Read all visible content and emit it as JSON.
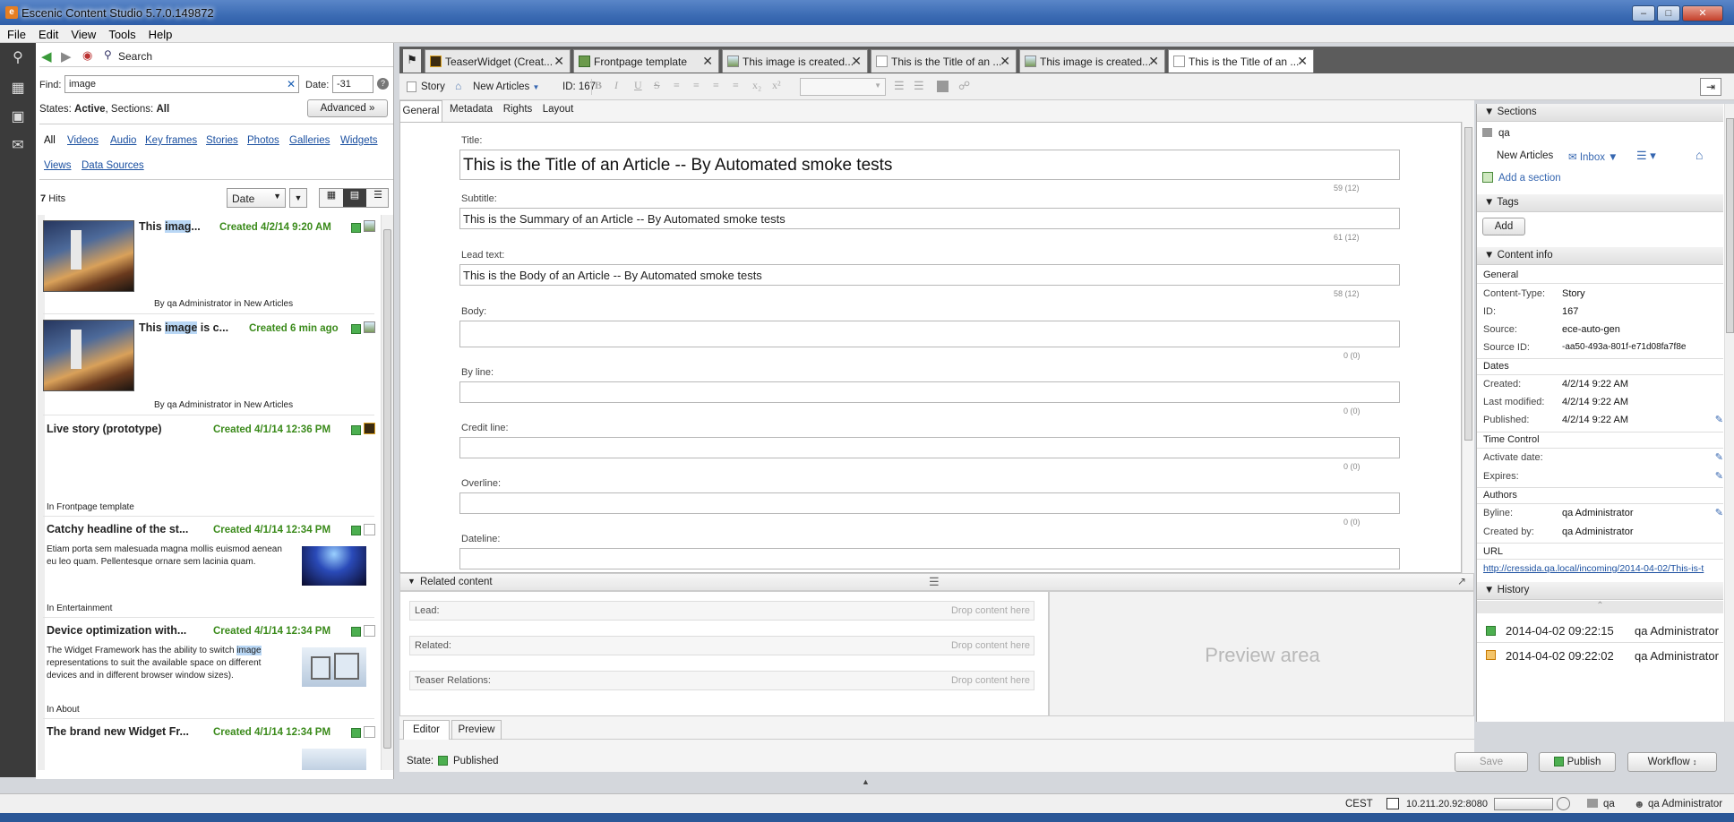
{
  "window": {
    "title": "Escenic Content Studio 5.7.0.149872",
    "app_icon_letter": "e"
  },
  "menu": [
    "File",
    "Edit",
    "View",
    "Tools",
    "Help"
  ],
  "search": {
    "nav_label": "Search",
    "find_label": "Find:",
    "find_value": "image",
    "date_label": "Date:",
    "date_value": "-31",
    "states_prefix": "States:",
    "states_value": "Active",
    "sections_prefix": ", Sections:",
    "sections_value": "All",
    "advanced_label": "Advanced",
    "filters_row1": [
      "All",
      "Videos",
      "Audio",
      "Key frames",
      "Stories",
      "Photos",
      "Galleries",
      "Widgets"
    ],
    "filters_row2": [
      "Views",
      "Data Sources"
    ],
    "hits_count": "7",
    "hits_label": "Hits",
    "sort_value": "Date"
  },
  "results": [
    {
      "title_pre": "This ",
      "title_hl": "imag",
      "title_post": "...",
      "created": "Created 4/2/14 9:20 AM",
      "by_prefix": "By",
      "by": "qa Administrator",
      "in_word": "in",
      "section": "New Articles"
    },
    {
      "title_pre": "This ",
      "title_hl": "image",
      "title_post": " is c...",
      "created": "Created 6 min ago",
      "by_prefix": "By",
      "by": "qa Administrator",
      "in_word": "in",
      "section": "New Articles"
    },
    {
      "title": "Live story (prototype)",
      "created": "Created 4/1/14 12:36 PM",
      "in_word": "In",
      "section": "Frontpage template"
    },
    {
      "title": "Catchy headline of the st...",
      "created": "Created 4/1/14 12:34 PM",
      "body": "Etiam porta sem malesuada magna mollis euismod aenean eu leo quam. Pellentesque ornare sem lacinia quam.",
      "in_word": "In",
      "section": "Entertainment"
    },
    {
      "title": "Device optimization with...",
      "created": "Created 4/1/14 12:34 PM",
      "body_pre": "The Widget Framework has the ability to switch ",
      "body_hl": "image",
      "body_post": " representations to suit the available space on different devices and in different browser window sizes).",
      "in_word": "In",
      "section": "About"
    },
    {
      "title": "The brand new Widget Fr...",
      "created": "Created 4/1/14 12:34 PM"
    }
  ],
  "tabs": [
    {
      "label": "TeaserWidget (Creat...",
      "icon": "widget-icon"
    },
    {
      "label": "Frontpage template",
      "icon": "page-icon"
    },
    {
      "label": "This image is created...",
      "icon": "image-icon"
    },
    {
      "label": "This is the Title of an ...",
      "icon": "doc-icon"
    },
    {
      "label": "This image is created...",
      "icon": "image-icon"
    },
    {
      "label": "This is the Title of an ...",
      "icon": "doc-icon",
      "active": true
    }
  ],
  "toolbar": {
    "type_label": "Story",
    "section_label": "New Articles",
    "id_label": "ID: 167"
  },
  "subtabs": [
    "General",
    "Metadata",
    "Rights",
    "Layout"
  ],
  "fields": [
    {
      "label": "Title:",
      "value": "This is the Title of an Article -- By Automated smoke tests",
      "count": "59 (12)"
    },
    {
      "label": "Subtitle:",
      "value": "This is the Summary of an Article -- By Automated smoke tests",
      "count": "61 (12)"
    },
    {
      "label": "Lead text:",
      "value": "This is the Body of an Article -- By Automated smoke tests",
      "count": "58 (12)"
    },
    {
      "label": "Body:",
      "value": "",
      "count": "0 (0)"
    },
    {
      "label": "By line:",
      "value": "",
      "count": "0 (0)"
    },
    {
      "label": "Credit line:",
      "value": "",
      "count": "0 (0)"
    },
    {
      "label": "Overline:",
      "value": "",
      "count": "0 (0)"
    },
    {
      "label": "Dateline:",
      "value": "",
      "count": ""
    }
  ],
  "related": {
    "header": "Related content",
    "rows": [
      {
        "label": "Lead:",
        "drop": "Drop content here"
      },
      {
        "label": "Related:",
        "drop": "Drop content here"
      },
      {
        "label": "Teaser Relations:",
        "drop": "Drop content here"
      }
    ],
    "preview_label": "Preview area"
  },
  "bottom_tabs": [
    "Editor",
    "Preview"
  ],
  "state": {
    "label": "State:",
    "value": "Published"
  },
  "actions": {
    "save": "Save",
    "publish": "Publish",
    "workflow": "Workflow"
  },
  "right": {
    "sections_header": "Sections",
    "section_name": "qa",
    "home_section": "New Articles",
    "inbox": "Inbox",
    "add_section": "Add a section",
    "tags_header": "Tags",
    "add_tag": "Add",
    "content_info_header": "Content info",
    "general_header": "General",
    "general": [
      {
        "k": "Content-Type:",
        "v": "Story"
      },
      {
        "k": "ID:",
        "v": "167"
      },
      {
        "k": "Source:",
        "v": "ece-auto-gen"
      },
      {
        "k": "Source ID:",
        "v": "-aa50-493a-801f-e71d08fa7f8e"
      }
    ],
    "dates_header": "Dates",
    "dates": [
      {
        "k": "Created:",
        "v": "4/2/14 9:22 AM"
      },
      {
        "k": "Last modified:",
        "v": "4/2/14 9:22 AM"
      },
      {
        "k": "Published:",
        "v": "4/2/14 9:22 AM"
      }
    ],
    "time_header": "Time Control",
    "time": [
      {
        "k": "Activate date:",
        "v": ""
      },
      {
        "k": "Expires:",
        "v": ""
      }
    ],
    "authors_header": "Authors",
    "authors": [
      {
        "k": "Byline:",
        "v": "qa Administrator"
      },
      {
        "k": "Created by:",
        "v": "qa Administrator"
      }
    ],
    "url_header": "URL",
    "url": "http://cressida.qa.local/incoming/2014-04-02/This-is-t",
    "history_header": "History",
    "history": [
      {
        "time": "2014-04-02 09:22:15",
        "user": "qa Administrator"
      },
      {
        "time": "2014-04-02 09:22:02",
        "user": "qa Administrator"
      }
    ]
  },
  "status": {
    "timezone": "CEST",
    "server": "10.211.20.92:8080",
    "publication": "qa",
    "user": "qa Administrator"
  }
}
